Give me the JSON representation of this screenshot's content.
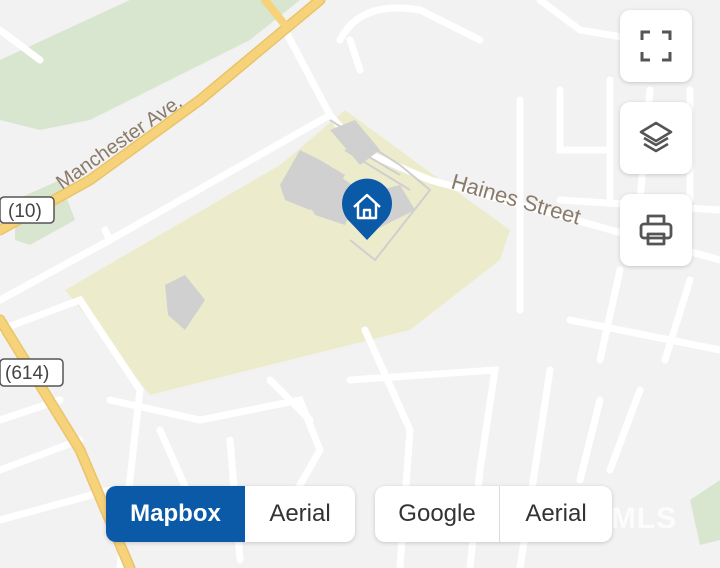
{
  "map": {
    "road_labels": {
      "manchester": "Manchester Ave.",
      "haines": "Haines Street"
    },
    "route_shields": [
      "(10)",
      "(614)"
    ],
    "watermark": "EY MLS",
    "colors": {
      "background": "#f2f2f2",
      "park": "#ececcc",
      "green": "#d8e6cf",
      "major_road": "#f6d27a",
      "minor_road": "#ffffff",
      "building": "#d0d0d0",
      "marker": "#0b5aa8"
    }
  },
  "controls": {
    "fullscreen_icon": "fullscreen-icon",
    "layers_icon": "layers-icon",
    "print_icon": "printer-icon"
  },
  "map_type": {
    "mapbox_group": {
      "primary": "Mapbox",
      "secondary": "Aerial",
      "selected": "Mapbox"
    },
    "google_group": {
      "primary": "Google",
      "secondary": "Aerial"
    }
  },
  "marker": {
    "icon": "home-icon"
  }
}
